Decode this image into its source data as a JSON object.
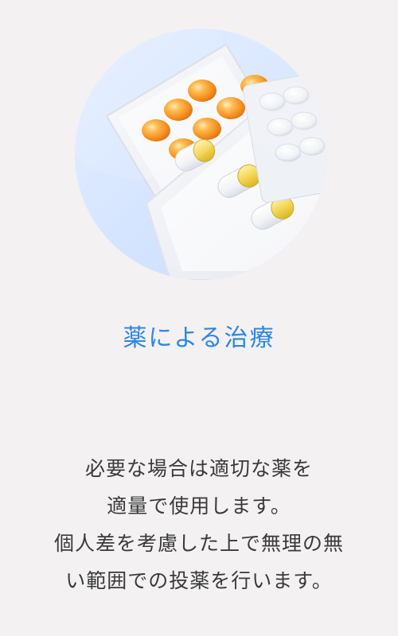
{
  "card": {
    "image_alt": "カプセルと錠剤の写真",
    "title": "薬による治療",
    "description_lines": [
      "必要な場合は適切な薬を",
      "適量で使用します。",
      "個人差を考慮した上で無理の無",
      "い範囲での投薬を行います。"
    ]
  },
  "colors": {
    "background": "#f3f1f2",
    "title": "#2f86e3",
    "text": "#3a3a3a"
  }
}
